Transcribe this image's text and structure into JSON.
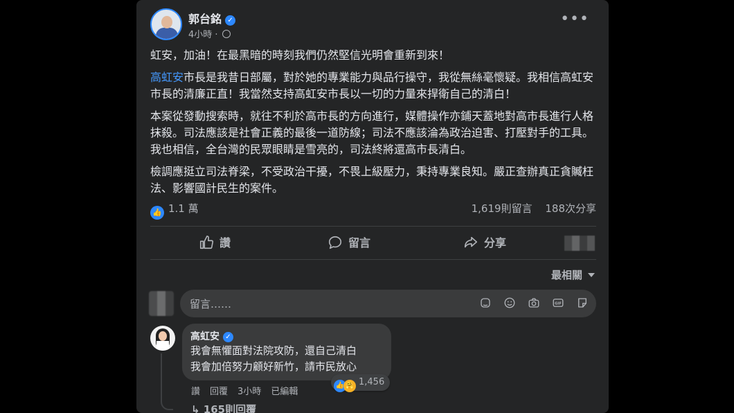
{
  "post": {
    "author": "郭台銘",
    "time": "4小時",
    "more_label": "•••",
    "paragraphs": {
      "p1": "虹安，加油！在最黑暗的時刻我們仍然堅信光明會重新到來！",
      "p2_link": "高虹安",
      "p2_rest": "市長是我昔日部屬，對於她的專業能力與品行操守，我從無絲毫懷疑。我相信高虹安市長的清廉正直！我當然支持高虹安市長以一切的力量來捍衛自己的清白！",
      "p3": "本案從發動搜索時，就往不利於高市長的方向進行，媒體操作亦鋪天蓋地對高市長進行人格抹殺。司法應該是社會正義的最後一道防線；司法不應該淪為政治迫害、打壓對手的工具。我也相信，全台灣的民眾眼睛是雪亮的，司法終將還高市長清白。",
      "p4": "檢調應挺立司法脊梁，不受政治干擾，不畏上級壓力，秉持專業良知。嚴正查辦真正貪贓枉法、影響國計民生的案件。"
    },
    "reactions_count": "1.1 萬",
    "comments_count": "1,619則留言",
    "shares_count": "188次分享"
  },
  "actions": {
    "like": "讚",
    "comment": "留言",
    "share": "分享"
  },
  "sort_label": "最相關",
  "composer": {
    "placeholder": "留言……"
  },
  "comment": {
    "author": "高虹安",
    "line1": "我會無懼面對法院攻防，還自己清白",
    "line2": "我會加倍努力顧好新竹，請市民放心",
    "reaction_count": "1,456",
    "like": "讚",
    "reply": "回覆",
    "time": "3小時",
    "edited": "已編輯",
    "replies_label": "165則回覆"
  },
  "colors": {
    "background": "#000000",
    "card": "#242526",
    "accent": "#2d88ff",
    "text": "#e4e6eb",
    "muted": "#b0b3b8"
  }
}
